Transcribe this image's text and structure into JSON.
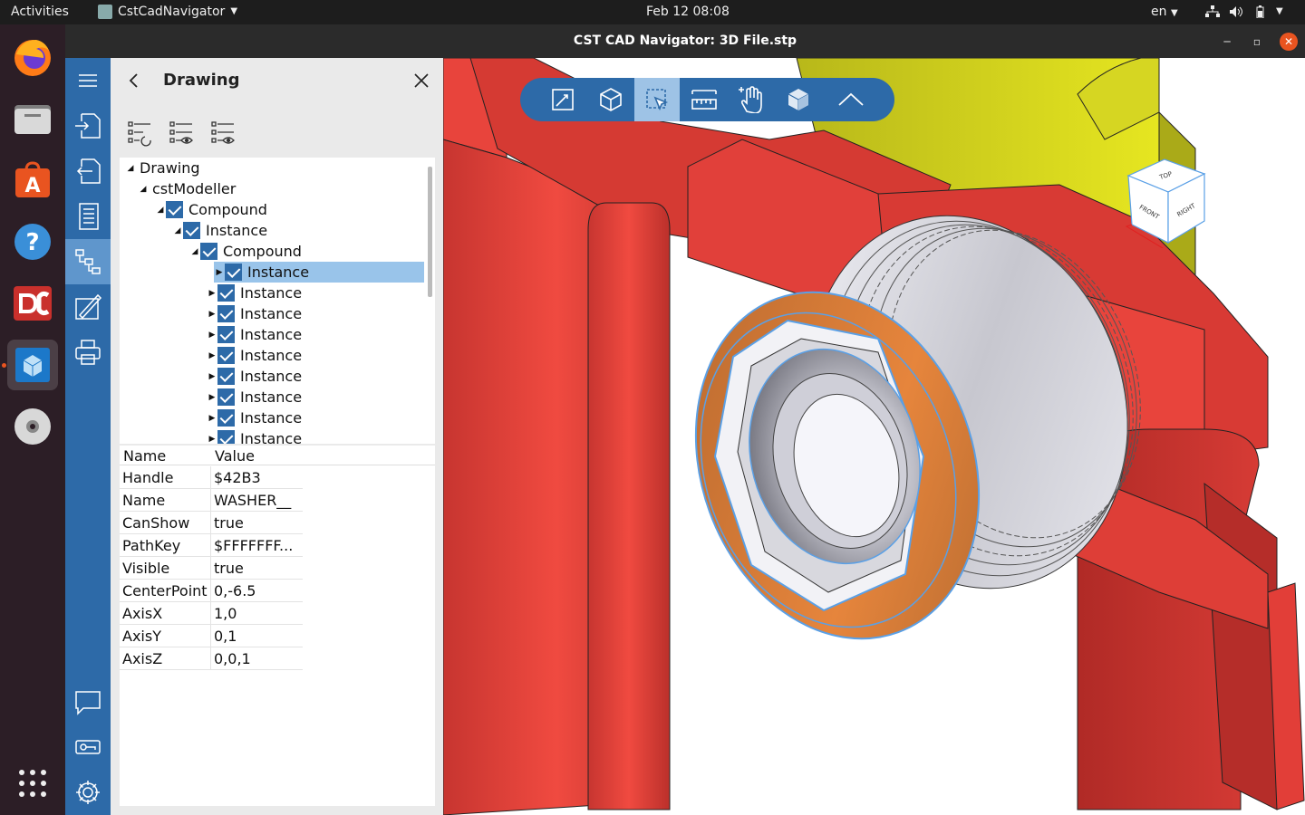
{
  "topbar": {
    "activities": "Activities",
    "app_name": "CstCadNavigator",
    "clock": "Feb 12  08:08",
    "language": "en"
  },
  "window": {
    "title": "CST CAD Navigator: 3D File.stp"
  },
  "panel": {
    "title": "Drawing",
    "tree": [
      {
        "label": "Drawing",
        "level": 0,
        "expanded": true,
        "checkbox": false,
        "selected": false
      },
      {
        "label": "cstModeller",
        "level": 1,
        "expanded": true,
        "checkbox": false,
        "selected": false
      },
      {
        "label": "Compound",
        "level": 2,
        "expanded": true,
        "checkbox": true,
        "selected": false
      },
      {
        "label": "Instance",
        "level": 3,
        "expanded": true,
        "checkbox": true,
        "selected": false
      },
      {
        "label": "Compound",
        "level": 4,
        "expanded": true,
        "checkbox": true,
        "selected": false
      },
      {
        "label": "Instance",
        "level": 5,
        "expanded": false,
        "checkbox": true,
        "selected": true
      },
      {
        "label": "Instance",
        "level": 5,
        "expanded": false,
        "checkbox": true,
        "selected": false
      },
      {
        "label": "Instance",
        "level": 5,
        "expanded": false,
        "checkbox": true,
        "selected": false
      },
      {
        "label": "Instance",
        "level": 5,
        "expanded": false,
        "checkbox": true,
        "selected": false
      },
      {
        "label": "Instance",
        "level": 5,
        "expanded": false,
        "checkbox": true,
        "selected": false
      },
      {
        "label": "Instance",
        "level": 5,
        "expanded": false,
        "checkbox": true,
        "selected": false
      },
      {
        "label": "Instance",
        "level": 5,
        "expanded": false,
        "checkbox": true,
        "selected": false
      },
      {
        "label": "Instance",
        "level": 5,
        "expanded": false,
        "checkbox": true,
        "selected": false
      },
      {
        "label": "Instance",
        "level": 5,
        "expanded": false,
        "checkbox": true,
        "selected": false
      }
    ],
    "props_header": {
      "name": "Name",
      "value": "Value"
    },
    "properties": [
      {
        "name": "Handle",
        "value": "$42B3"
      },
      {
        "name": "Name",
        "value": "WASHER__"
      },
      {
        "name": "CanShow",
        "value": "true"
      },
      {
        "name": "PathKey",
        "value": "$FFFFFFF..."
      },
      {
        "name": "Visible",
        "value": "true"
      },
      {
        "name": "CenterPoint",
        "value": "0,-6.5"
      },
      {
        "name": "AxisX",
        "value": "1,0"
      },
      {
        "name": "AxisY",
        "value": "0,1"
      },
      {
        "name": "AxisZ",
        "value": "0,0,1"
      }
    ]
  },
  "navcube": {
    "top": "TOP",
    "front": "FRONT",
    "right": "RIGHT"
  },
  "colors": {
    "rail": "#2d6aa8",
    "rail_active": "#5f96cc",
    "selection": "#99c4ea",
    "part_red": "#d83a34",
    "part_yellow": "#c9c920",
    "highlight_orange": "#c8743a",
    "highlight_edge": "#5aa0e6"
  }
}
